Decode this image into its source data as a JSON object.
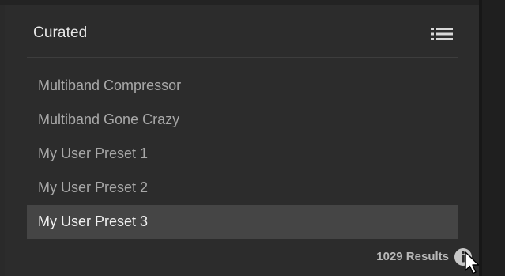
{
  "header": {
    "title": "Curated",
    "view_toggle_icon": "list-view-icon"
  },
  "presets": [
    {
      "label": "Multiband Compressor",
      "selected": false
    },
    {
      "label": "Multiband Gone Crazy",
      "selected": false
    },
    {
      "label": "My User Preset 1",
      "selected": false
    },
    {
      "label": "My User Preset 2",
      "selected": false
    },
    {
      "label": "My User Preset 3",
      "selected": true
    }
  ],
  "footer": {
    "results_text": "1029 Results",
    "info_icon": "info-icon"
  },
  "colors": {
    "panel_bg": "#2c2c2c",
    "selected_row_bg": "#454545",
    "text_muted": "#a8a8a8",
    "text_selected": "#f0f0f0"
  }
}
